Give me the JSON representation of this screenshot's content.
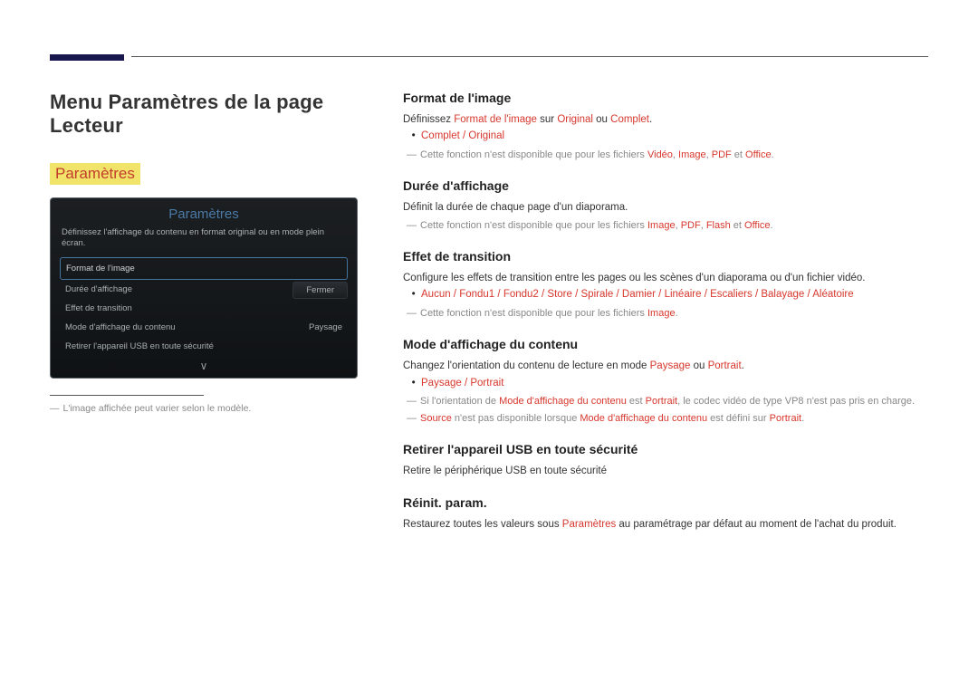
{
  "page_title": "Menu Paramètres de la page Lecteur",
  "section_label": "Paramètres",
  "ui_panel": {
    "title": "Paramètres",
    "desc": "Définissez l'affichage du contenu en format original ou en mode plein écran.",
    "item_sel": "Format de l'image",
    "close": "Fermer",
    "item_duree": "Durée d'affichage",
    "item_effet": "Effet de transition",
    "item_mode": "Mode d'affichage du contenu",
    "item_mode_val": "Paysage",
    "item_usb": "Retirer l'appareil USB en toute sécurité",
    "chevron": "∨"
  },
  "caption": {
    "dash": "―",
    "text": "L'image affichée peut varier selon le modèle."
  },
  "format": {
    "h": "Format de l'image",
    "p_pre": "Définissez ",
    "p_b1": "Format de l'image",
    "p_mid1": " sur ",
    "p_b2": "Original",
    "p_mid2": " ou ",
    "p_b3": "Complet",
    "p_post": ".",
    "opt1": "Complet",
    "opt_sep": " / ",
    "opt2": "Original",
    "note_pre": "Cette fonction n'est disponible que pour les fichiers ",
    "note_r1": "Vidéo",
    "note_c1": ", ",
    "note_r2": "Image",
    "note_c2": ", ",
    "note_r3": "PDF",
    "note_c3": " et ",
    "note_r4": "Office",
    "note_post": "."
  },
  "duree": {
    "h": "Durée d'affichage",
    "p": "Définit la durée de chaque page d'un diaporama.",
    "note_pre": "Cette fonction n'est disponible que pour les fichiers ",
    "note_r1": "Image",
    "note_c1": ", ",
    "note_r2": "PDF",
    "note_c2": ", ",
    "note_r3": "Flash",
    "note_c3": " et ",
    "note_r4": "Office",
    "note_post": "."
  },
  "effet": {
    "h": "Effet de transition",
    "p": "Configure les effets de transition entre les pages ou les scènes d'un diaporama ou d'un fichier vidéo.",
    "opts": [
      "Aucun",
      "Fondu1",
      "Fondu2",
      "Store",
      "Spirale",
      "Damier",
      "Linéaire",
      "Escaliers",
      "Balayage",
      "Aléatoire"
    ],
    "sep": " / ",
    "note_pre": "Cette fonction n'est disponible que pour les fichiers ",
    "note_r1": "Image",
    "note_post": "."
  },
  "mode": {
    "h": "Mode d'affichage du contenu",
    "p_pre": "Changez l'orientation du contenu de lecture en mode ",
    "p_b1": "Paysage",
    "p_mid": " ou ",
    "p_b2": "Portrait",
    "p_post": ".",
    "opt1": "Paysage",
    "opt_sep": " / ",
    "opt2": "Portrait",
    "note1_pre": "Si l'orientation de ",
    "note1_b1": "Mode d'affichage du contenu",
    "note1_mid1": " est ",
    "note1_b2": "Portrait",
    "note1_post": ", le codec vidéo de type VP8 n'est pas pris en charge.",
    "note2_b1": "Source",
    "note2_mid1": " n'est pas disponible lorsque ",
    "note2_b2": "Mode d'affichage du contenu",
    "note2_mid2": " est défini sur ",
    "note2_b3": "Portrait",
    "note2_post": "."
  },
  "usb": {
    "h": "Retirer l'appareil USB en toute sécurité",
    "p": "Retire le périphérique USB en toute sécurité"
  },
  "reinit": {
    "h": "Réinit. param.",
    "p_pre": "Restaurez toutes les valeurs sous ",
    "p_b1": "Paramètres",
    "p_post": " au paramétrage par défaut au moment de l'achat du produit."
  }
}
